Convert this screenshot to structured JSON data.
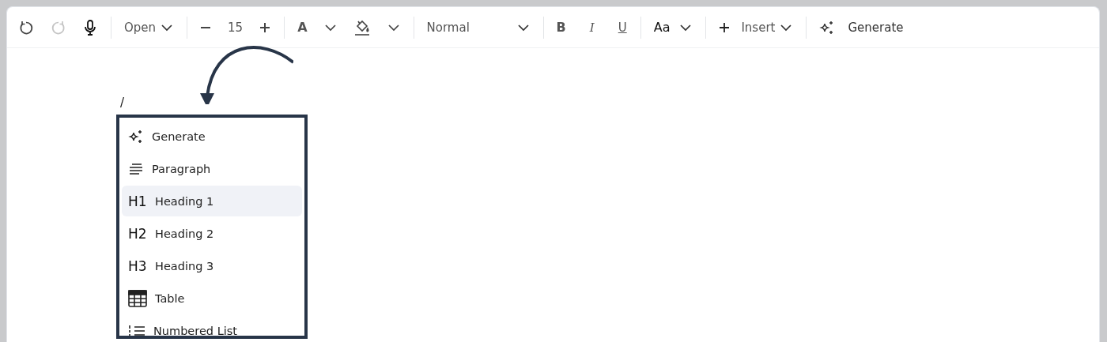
{
  "toolbar": {
    "undo": {
      "disabled": false
    },
    "redo": {
      "disabled": true
    },
    "font_family": "Open",
    "font_size": "15",
    "font_color": "A",
    "block_style": "Normal",
    "bold": "B",
    "italic": "I",
    "underline": "U",
    "text_case": "Aa",
    "insert": "Insert",
    "generate": "Generate"
  },
  "editor": {
    "typed_text": "/"
  },
  "command_menu": {
    "items": [
      {
        "kind": "sparkle",
        "label": "Generate",
        "selected": false
      },
      {
        "kind": "lines",
        "label": "Paragraph",
        "selected": false
      },
      {
        "kind": "text",
        "icon_text": "H1",
        "label": "Heading 1",
        "selected": true
      },
      {
        "kind": "text",
        "icon_text": "H2",
        "label": "Heading 2",
        "selected": false
      },
      {
        "kind": "text",
        "icon_text": "H3",
        "label": "Heading 3",
        "selected": false
      },
      {
        "kind": "table",
        "label": "Table",
        "selected": false
      },
      {
        "kind": "numbered",
        "label": "Numbered List",
        "selected": false
      }
    ]
  }
}
